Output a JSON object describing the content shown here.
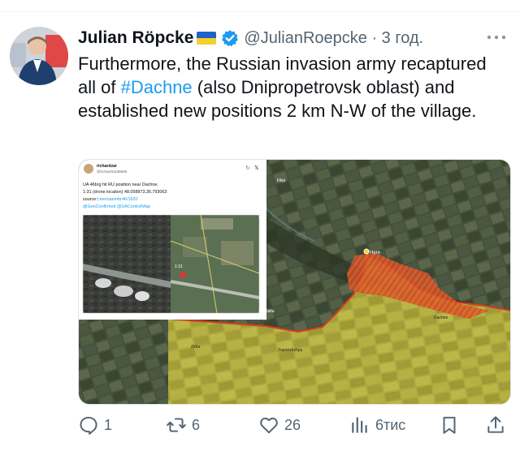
{
  "tweet": {
    "author_name": "Julian Röpcke",
    "flag_icon": "ukraine-flag-icon",
    "verified_icon": "verified-badge-icon",
    "handle_time": "@JulianRoepcke · 3 год.",
    "text_before": "Furthermore, the Russian invasion army recaptured all of ",
    "hashtag": "#Dachne",
    "text_after": " (also Dnipropetrovsk oblast) and established new positions 2 km N-W of the village."
  },
  "embedded_post": {
    "author": "richardzai",
    "handle": "@richardzai38586",
    "line1": "UA 46brg hit RU position near Dachne.",
    "line2": "1:31 (drone location) 48.058873,36.793063",
    "source_prefix": "source:",
    "source_link": "t.me/oaembr46/1620",
    "tags": "@GeoConfirmed @UAControlMap",
    "inset_label": "1:31"
  },
  "map_labels": {
    "top_village": "Filija",
    "marker": "Here",
    "right_village": "Dachne",
    "left_village": "Jalta",
    "bottom_left": "Zirka",
    "bottom_center": "Zaporizhzhya"
  },
  "actions": {
    "replies": "1",
    "reposts": "6",
    "likes": "26",
    "views": "6тис"
  },
  "colors": {
    "accent": "#1d9bf0",
    "muted": "#536471",
    "occupied": "#c9c238",
    "contested": "#e25a2a"
  }
}
